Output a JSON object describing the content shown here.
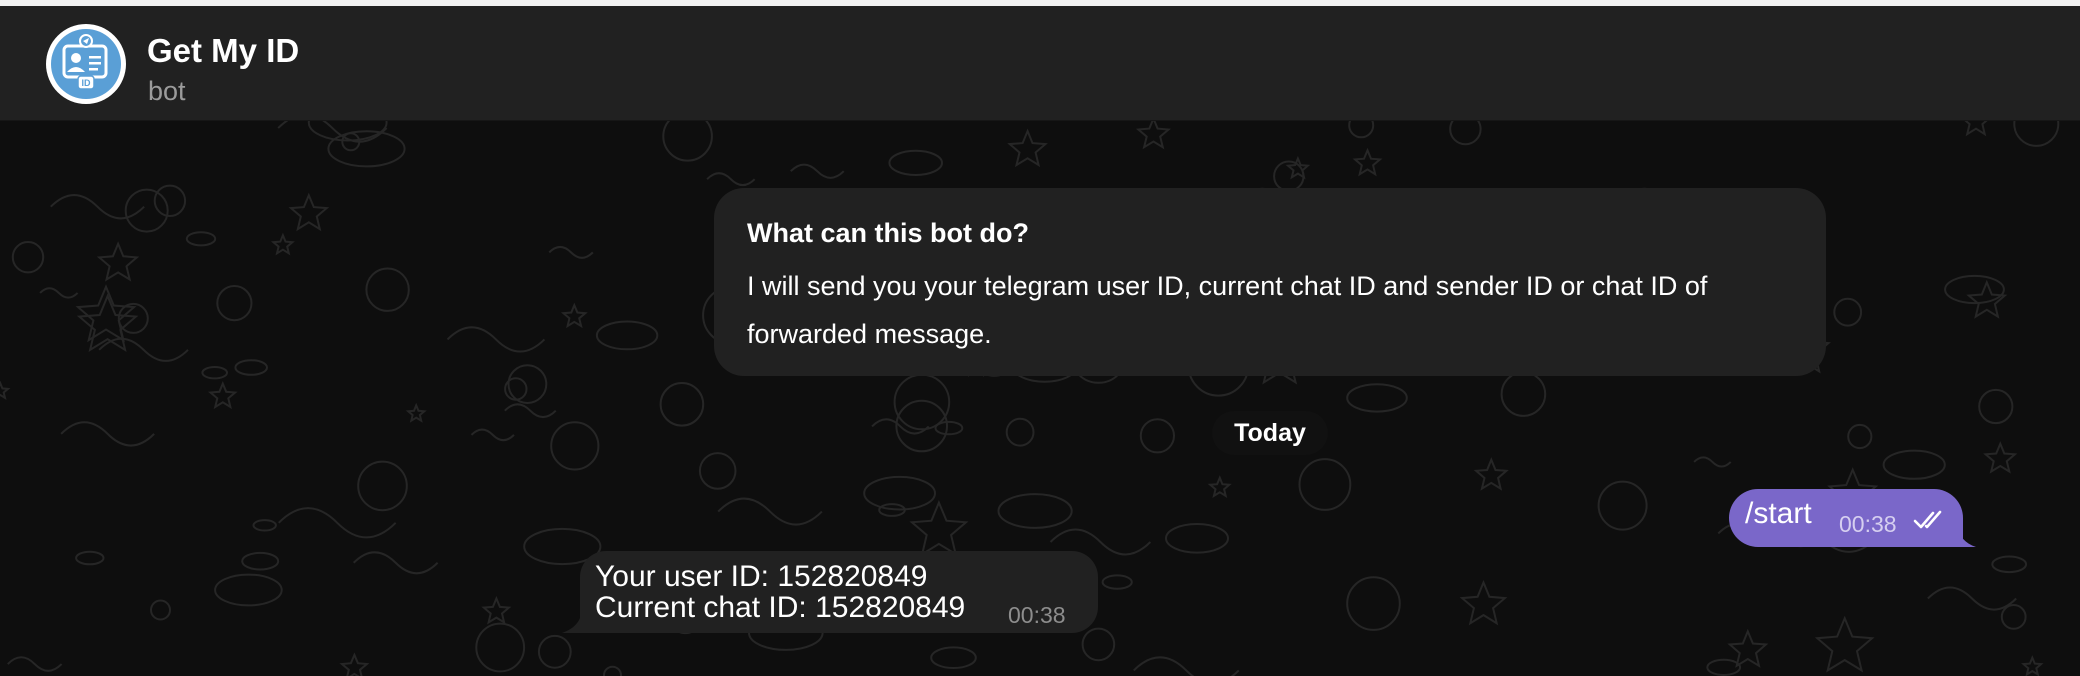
{
  "header": {
    "title": "Get My ID",
    "status": "bot",
    "avatar_badge": "ID",
    "avatar_icon": "id-card-icon",
    "avatar_color": "#5a9fd6"
  },
  "info_card": {
    "title": "What can this bot do?",
    "text": "I will send you your telegram user ID, current chat ID and sender ID or chat ID of forwarded message."
  },
  "date_separator": "Today",
  "messages": [
    {
      "direction": "outgoing",
      "text": "/start",
      "time": "00:38",
      "status_icon": "double-check-icon",
      "bubble_color": "#7a67c9"
    },
    {
      "direction": "incoming",
      "lines": [
        {
          "label": "Your user ID: ",
          "value": "152820849"
        },
        {
          "label": "Current chat ID: ",
          "value": "152820849"
        }
      ],
      "time": "00:38",
      "bubble_color": "#212121"
    }
  ],
  "colors": {
    "header_bg": "#212121",
    "chat_bg": "#0e0e0e",
    "accent": "#7a67c9"
  }
}
